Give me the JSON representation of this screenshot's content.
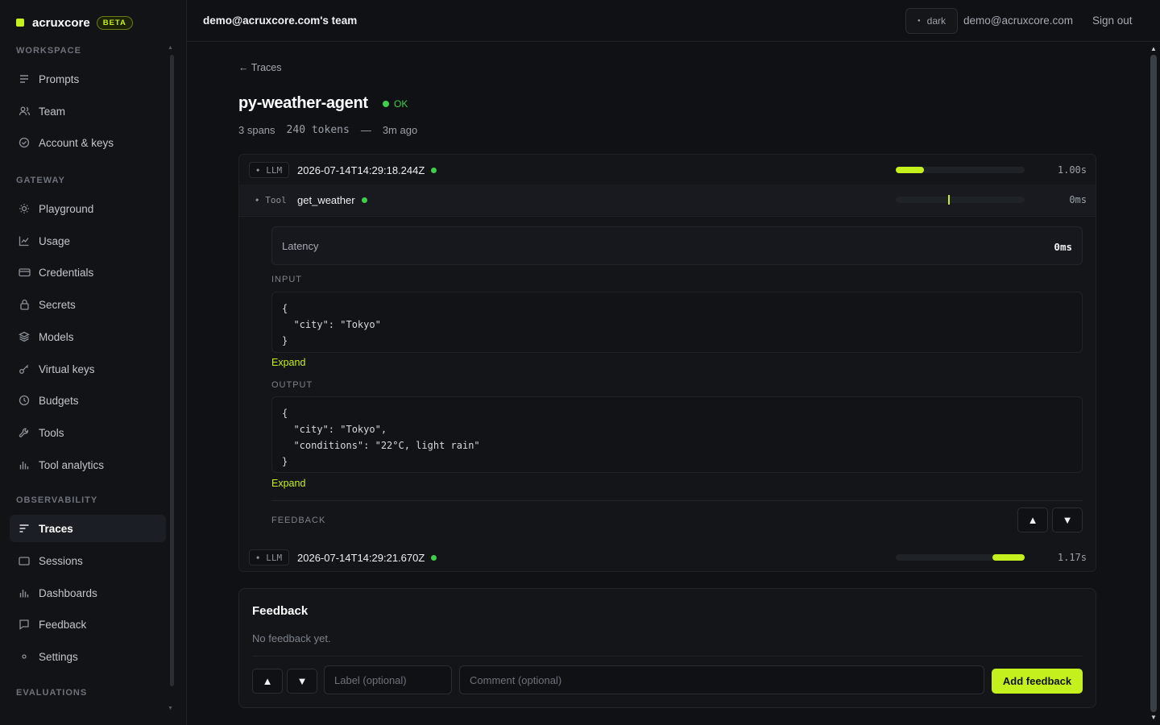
{
  "brand": {
    "name": "acruxcore",
    "badge": "BETA"
  },
  "sidebar": {
    "sections": [
      {
        "label": "WORKSPACE",
        "items": [
          {
            "label": "Prompts",
            "icon": "list-icon"
          },
          {
            "label": "Team",
            "icon": "users-icon"
          },
          {
            "label": "Account & keys",
            "icon": "check-circle-icon"
          }
        ]
      },
      {
        "label": "GATEWAY",
        "items": [
          {
            "label": "Playground",
            "icon": "sun-icon"
          },
          {
            "label": "Usage",
            "icon": "line-chart-icon"
          },
          {
            "label": "Credentials",
            "icon": "card-icon"
          },
          {
            "label": "Secrets",
            "icon": "lock-icon"
          },
          {
            "label": "Models",
            "icon": "layers-icon"
          },
          {
            "label": "Virtual keys",
            "icon": "key-icon"
          },
          {
            "label": "Budgets",
            "icon": "clock-icon"
          },
          {
            "label": "Tools",
            "icon": "wrench-icon"
          },
          {
            "label": "Tool analytics",
            "icon": "bar-chart-icon"
          }
        ]
      },
      {
        "label": "OBSERVABILITY",
        "items": [
          {
            "label": "Traces",
            "icon": "traces-icon",
            "active": true
          },
          {
            "label": "Sessions",
            "icon": "window-icon"
          },
          {
            "label": "Dashboards",
            "icon": "bar-chart-icon"
          },
          {
            "label": "Feedback",
            "icon": "message-icon"
          },
          {
            "label": "Settings",
            "icon": "gear-icon"
          }
        ]
      },
      {
        "label": "EVALUATIONS",
        "items": []
      }
    ]
  },
  "topbar": {
    "team": "demo@acruxcore.com's team",
    "theme": "dark",
    "email": "demo@acruxcore.com",
    "signout": "Sign out"
  },
  "trace": {
    "back": "Traces",
    "name": "py-weather-agent",
    "status": "OK",
    "spans_count": "3 spans",
    "tokens": "240 tokens",
    "separator": "—",
    "age": "3m ago"
  },
  "spans": [
    {
      "kind": "LLM",
      "name": "2026-07-14T14:29:18.244Z",
      "duration": "1.00s",
      "bar_start": 0.0,
      "bar_end": 0.22
    },
    {
      "kind": "Tool",
      "name": "get_weather",
      "duration": "0ms",
      "bar_start": 0.3,
      "bar_end": 0.3,
      "selected": true
    },
    {
      "kind": "LLM",
      "name": "2026-07-14T14:29:21.670Z",
      "duration": "1.17s",
      "bar_start": 0.75,
      "bar_end": 1.0
    }
  ],
  "detail": {
    "latency_label": "Latency",
    "latency_value": "0ms",
    "input_label": "INPUT",
    "input_code": "{\n  \"city\": \"Tokyo\"\n}",
    "output_label": "OUTPUT",
    "output_code": "{\n  \"city\": \"Tokyo\",\n  \"conditions\": \"22°C, light rain\"\n}",
    "expand": "Expand",
    "feedback_label": "FEEDBACK"
  },
  "feedback": {
    "title": "Feedback",
    "empty": "No feedback yet.",
    "label_placeholder": "Label (optional)",
    "comment_placeholder": "Comment (optional)",
    "submit": "Add feedback"
  },
  "colors": {
    "accent": "#c4f01e",
    "ok": "#3fcf4a",
    "bg": "#0f1115"
  }
}
